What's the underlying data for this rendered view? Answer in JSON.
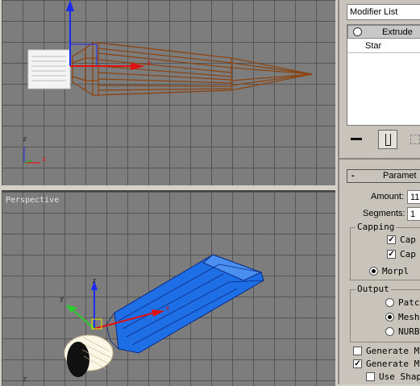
{
  "viewport_perspective": {
    "label": "Perspective"
  },
  "axes": {
    "x": "x",
    "y": "y",
    "z": "z"
  },
  "modifier_panel": {
    "dropdown_value": "Modifier List",
    "stack_items": [
      "Extrude",
      "Star"
    ]
  },
  "rollout": {
    "title": "Paramet",
    "amount_label": "Amount:",
    "amount_value": "11",
    "segments_label": "Segments:",
    "segments_value": "1",
    "capping_title": "Capping",
    "cap_start": "Cap",
    "cap_end": "Cap",
    "morph": "Morpl",
    "output_title": "Output",
    "patch": "Patc",
    "mesh": "Mesh",
    "nurbs": "NURB",
    "gen_map1": "Generate M",
    "gen_map2": "Generate M",
    "use_shape": "Use Shap",
    "collapse_symbol": "-"
  },
  "colors": {
    "viewport_bg": "#7d7d7d",
    "wire": "#8b4513",
    "selected_mesh": "#1e6ee6",
    "active_item": "#c8c8c8"
  }
}
